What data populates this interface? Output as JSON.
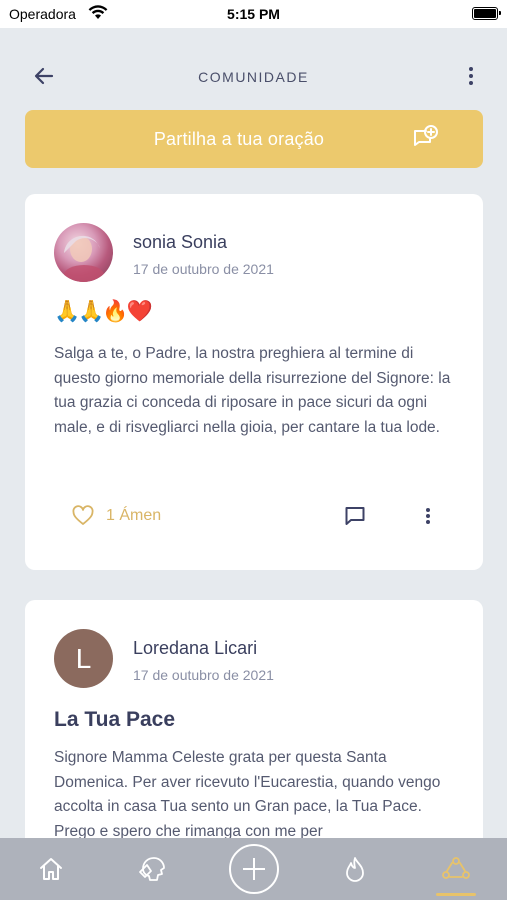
{
  "status_bar": {
    "carrier": "Operadora",
    "time": "5:15 PM"
  },
  "header": {
    "title": "COMUNIDADE"
  },
  "share_button": {
    "label": "Partilha a tua oração"
  },
  "posts": [
    {
      "author": "sonia Sonia",
      "date": "17 de outubro de 2021",
      "emojis": "🙏🙏🔥❤️",
      "body": "Salga a te, o Padre, la nostra preghiera al termine di questo giorno memoriale della risurrezione del Signore: la tua grazia ci conceda di riposare in pace sicuri da ogni male, e di risvegliarci nella gioia, per cantare la tua lode.",
      "amen_label": "1 Ámen"
    },
    {
      "author": "Loredana Licari",
      "avatar_letter": "L",
      "date": "17 de outubro de 2021",
      "title": "La Tua Pace",
      "body": "Signore Mamma Celeste grata per questa Santa Domenica. Per aver ricevuto l'Eucarestia, quando vengo accolta in casa Tua sento un Gran pace, la Tua Pace. Prego e spero che rimanga con me per"
    }
  ],
  "tab_bar": {
    "items": [
      "home-icon",
      "praying-head-icon",
      "add-icon",
      "flame-icon",
      "community-icon"
    ],
    "active": "community-icon"
  },
  "colors": {
    "accent": "#ecc96d",
    "accent_text": "#d9b566",
    "background": "#e6eaee",
    "tab_bar": "#aeb2bb"
  }
}
